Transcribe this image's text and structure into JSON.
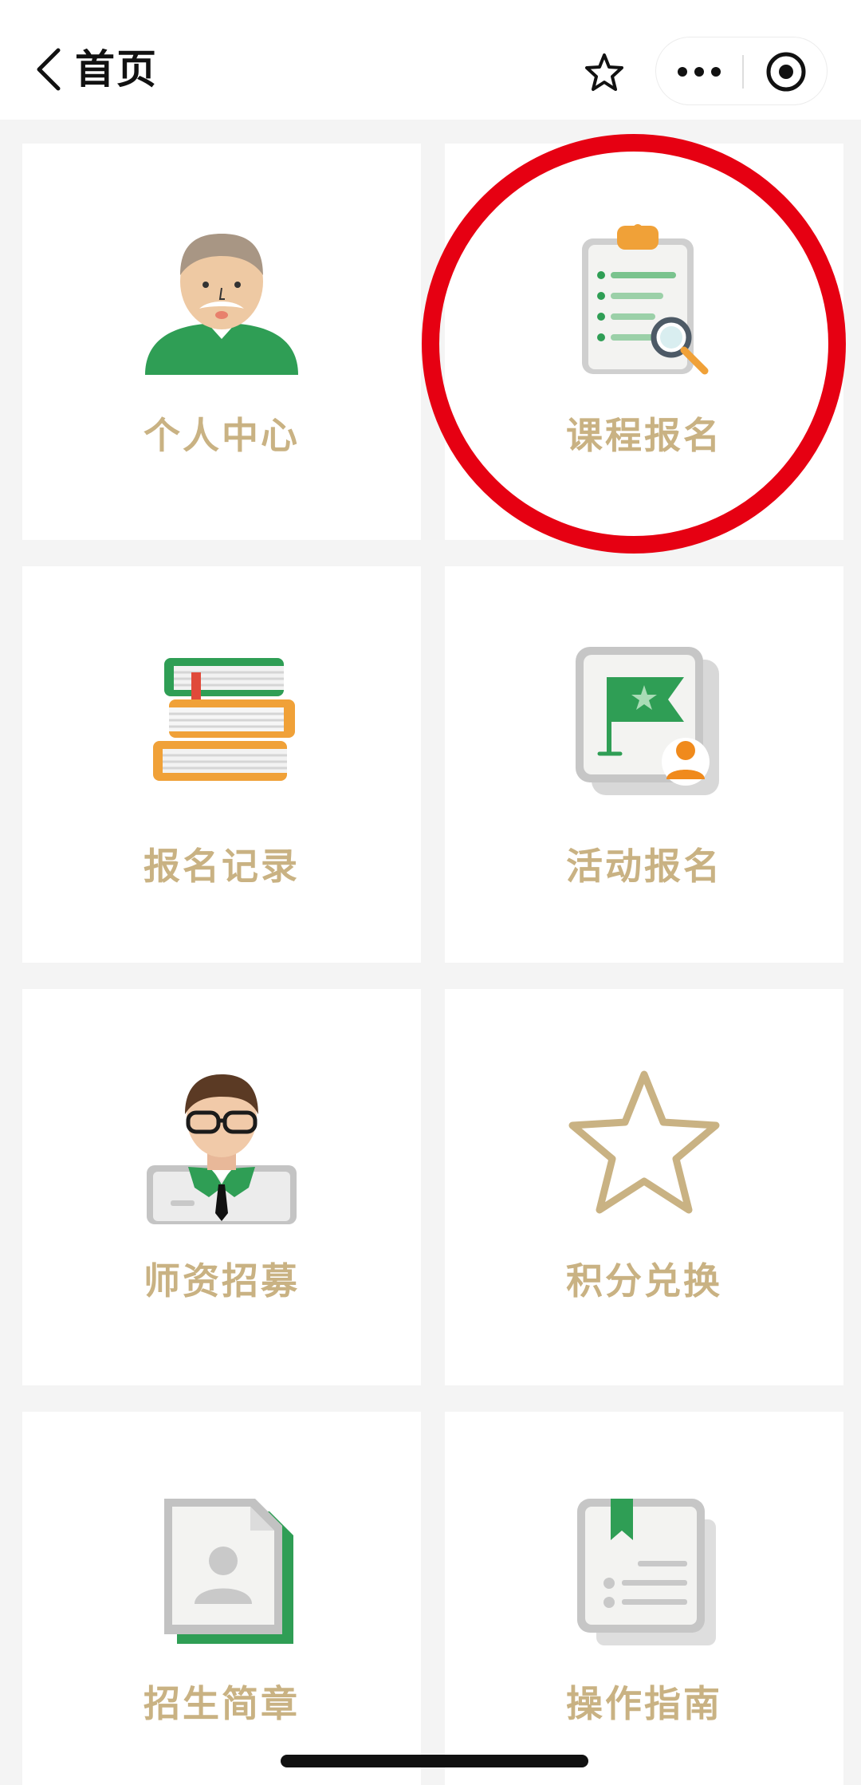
{
  "header": {
    "title": "首页"
  },
  "tiles": [
    {
      "label": "个人中心",
      "icon": "user-avatar-icon"
    },
    {
      "label": "课程报名",
      "icon": "clipboard-search-icon"
    },
    {
      "label": "报名记录",
      "icon": "books-icon"
    },
    {
      "label": "活动报名",
      "icon": "flag-user-icon"
    },
    {
      "label": "师资招募",
      "icon": "teacher-icon"
    },
    {
      "label": "积分兑换",
      "icon": "star-icon"
    },
    {
      "label": "招生简章",
      "icon": "profile-document-icon"
    },
    {
      "label": "操作指南",
      "icon": "guide-book-icon"
    }
  ],
  "colors": {
    "label": "#c9b283",
    "green": "#2f9e55",
    "orange": "#f0a138",
    "highlight": "#e60012"
  }
}
